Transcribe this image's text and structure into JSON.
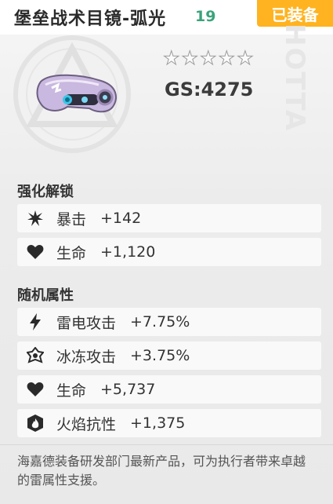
{
  "header": {
    "title": "堡垒战术目镜-弧光",
    "level": "19",
    "equipped_label": "已装备",
    "accent_color": "#ffb320",
    "level_color": "#3aa37b"
  },
  "item": {
    "stars_total": 5,
    "stars_filled": 0,
    "gs": "GS:4275",
    "image_icon": "goggles-icon",
    "watermark_text": "HOTTA"
  },
  "enhance": {
    "title": "强化解锁",
    "stats": [
      {
        "icon": "crit-burst-icon",
        "name": "暴击",
        "value": "+142"
      },
      {
        "icon": "heart-icon",
        "name": "生命",
        "value": "+1,120"
      }
    ]
  },
  "random": {
    "title": "随机属性",
    "stats": [
      {
        "icon": "lightning-icon",
        "name": "雷电攻击",
        "value": "+7.75%"
      },
      {
        "icon": "snowflake-icon",
        "name": "冰冻攻击",
        "value": "+3.75%"
      },
      {
        "icon": "heart-icon",
        "name": "生命",
        "value": "+5,737"
      },
      {
        "icon": "flame-shield-icon",
        "name": "火焰抗性",
        "value": "+1,375"
      }
    ]
  },
  "description": "海嘉德装备研发部门最新产品，可为执行者带来卓越的雷属性支援。"
}
